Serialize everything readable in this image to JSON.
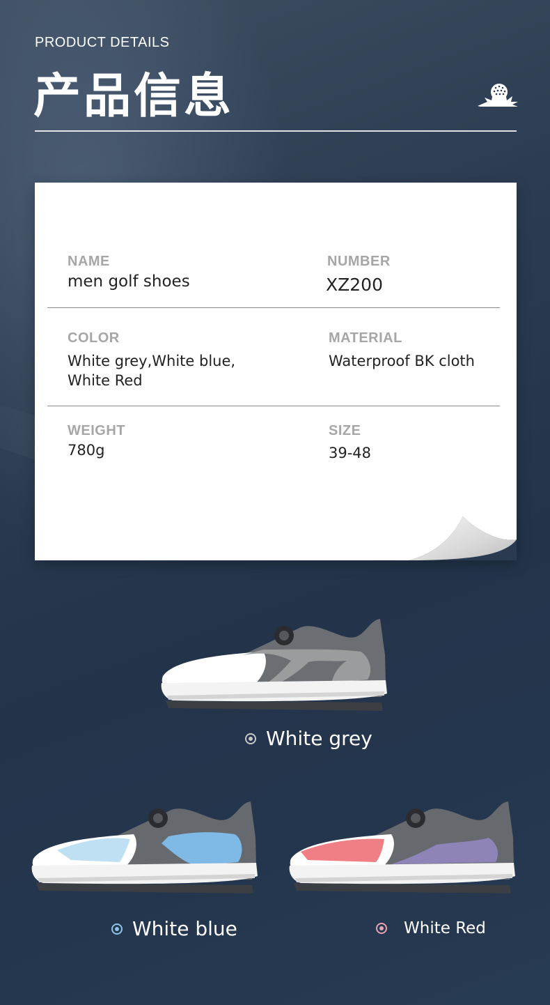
{
  "header": {
    "subtitle": "PRODUCT DETAILS",
    "title": "产品信息",
    "logo_icon": "golf-ball-logo-icon"
  },
  "details": {
    "name": {
      "label": "NAME",
      "value": "men golf shoes"
    },
    "number": {
      "label": "NUMBER",
      "value": "XZ200"
    },
    "color": {
      "label": "COLOR",
      "value_line1": "White grey,White blue,",
      "value_line2": "White Red"
    },
    "material": {
      "label": "MATERIAL",
      "value": "Waterproof BK cloth"
    },
    "weight": {
      "label": "WEIGHT",
      "value": "780g"
    },
    "size": {
      "label": "SIZE",
      "value": "39-48"
    }
  },
  "variants": [
    {
      "label": "White grey",
      "dot_color": "#c8c8c8",
      "accent": "#9a9c9e"
    },
    {
      "label": "White blue",
      "dot_color": "#8fc3ea",
      "accent": "#7fb9e6"
    },
    {
      "label": "White Red",
      "dot_color": "#e8a4b4",
      "accent": "#ef7f84"
    }
  ],
  "colors": {
    "background": "#2a3a50",
    "card": "#ffffff",
    "label": "#a6a6a6",
    "value": "#222222"
  }
}
